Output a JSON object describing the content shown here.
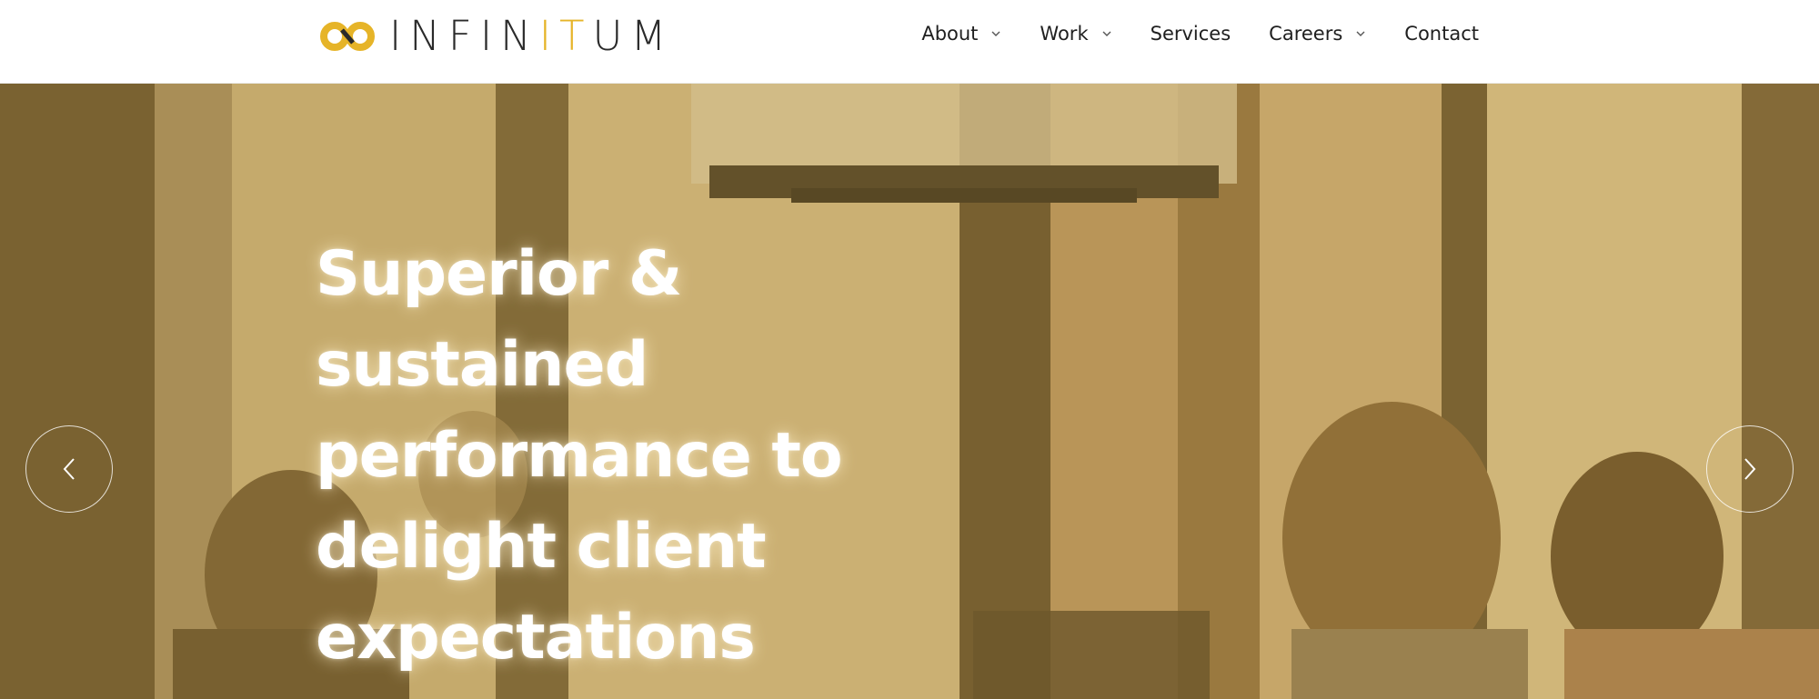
{
  "brand": {
    "name_part1": "INFIN",
    "name_accent": "IT",
    "name_part2": "UM",
    "logo_icon": "infinity-icon",
    "accent_color": "#e6b428"
  },
  "nav": {
    "items": [
      {
        "label": "About",
        "has_dropdown": true
      },
      {
        "label": "Work",
        "has_dropdown": true
      },
      {
        "label": "Services",
        "has_dropdown": false
      },
      {
        "label": "Careers",
        "has_dropdown": true
      },
      {
        "label": "Contact",
        "has_dropdown": false
      }
    ]
  },
  "hero": {
    "headline_lines": [
      "Superior &",
      "sustained",
      "performance to",
      "delight client",
      "expectations"
    ],
    "prev_icon": "chevron-left-icon",
    "next_icon": "chevron-right-icon",
    "overlay_color": "#c4a050"
  }
}
